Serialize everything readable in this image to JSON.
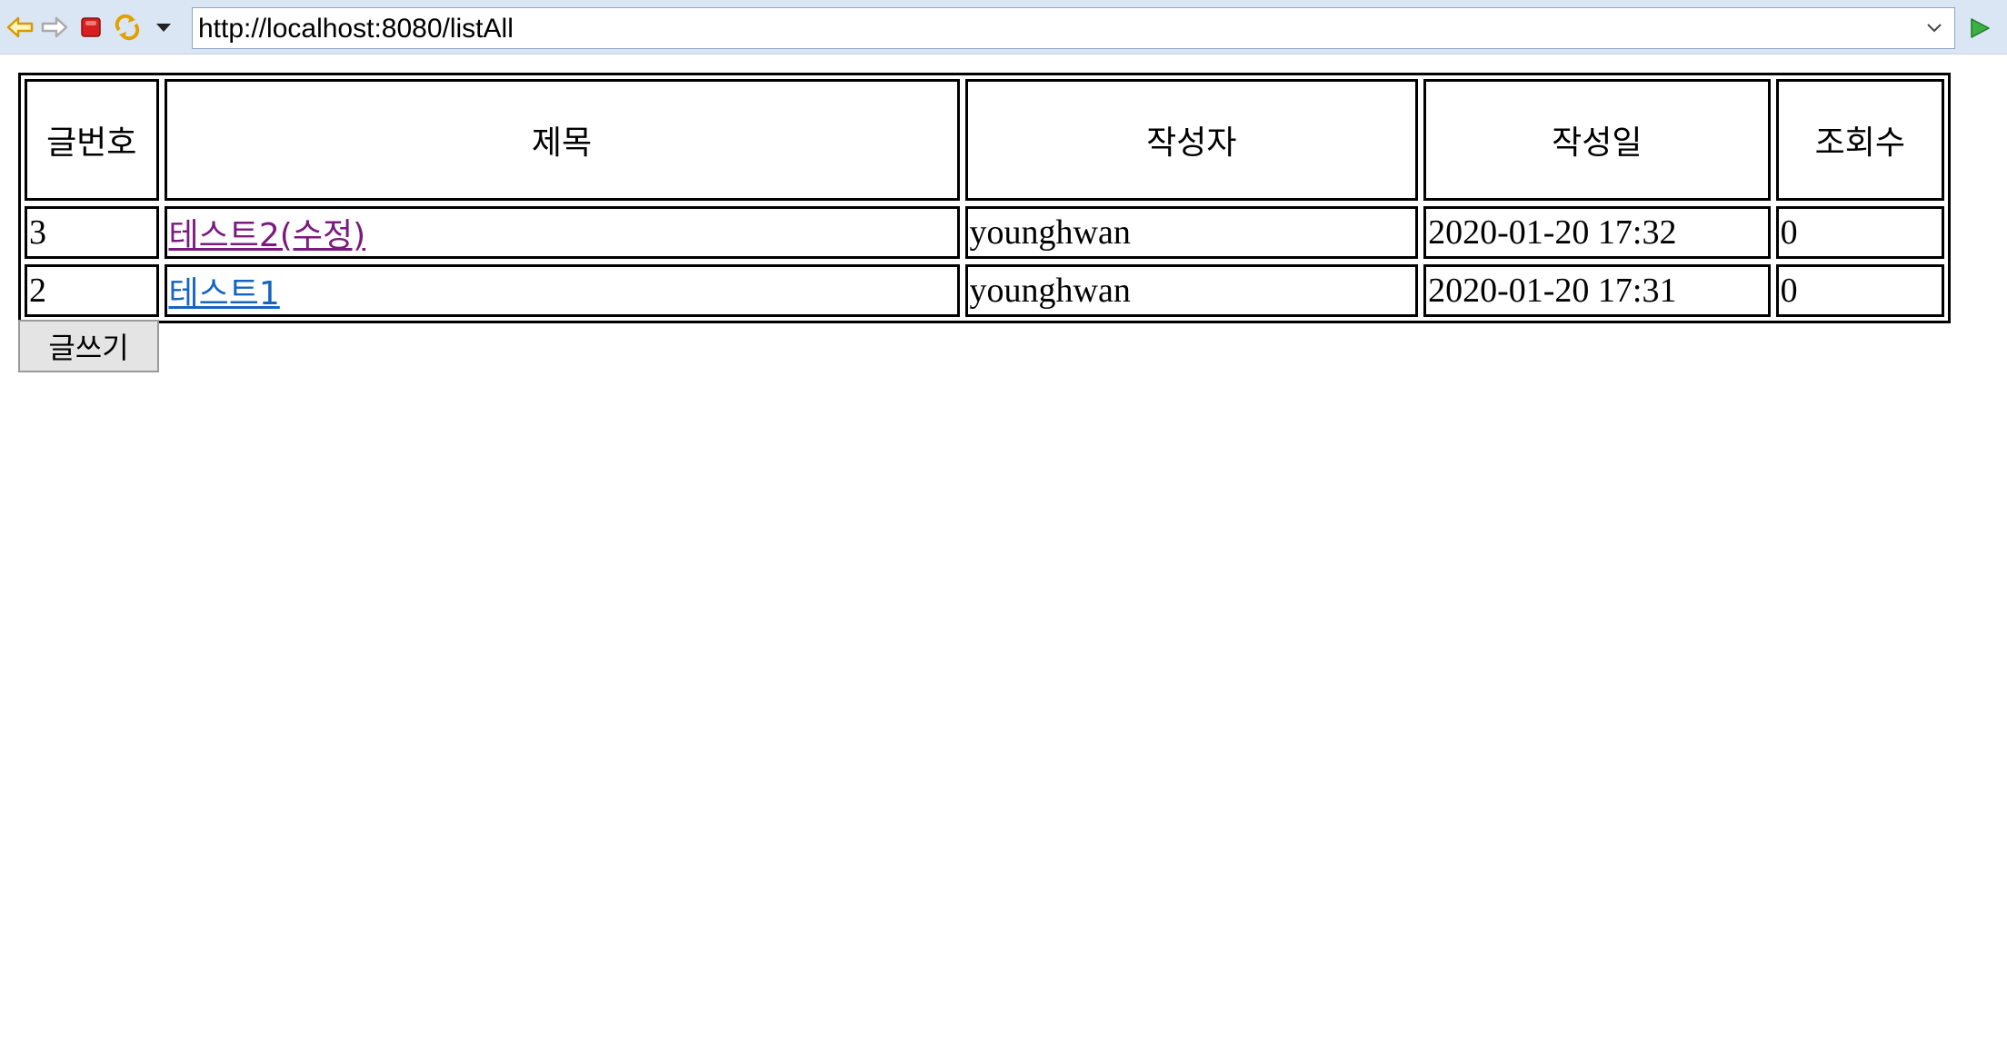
{
  "browser": {
    "url": "http://localhost:8080/listAll",
    "icons": {
      "back": "back-arrow-icon",
      "forward": "forward-arrow-icon",
      "stop": "stop-icon",
      "refresh": "refresh-icon",
      "menu": "dropdown-triangle-icon",
      "url_dropdown": "chevron-down-icon",
      "go": "go-play-icon"
    },
    "colors": {
      "toolbar_bg": "#dbe6f4",
      "back_forward": "#f0b400",
      "stop": "#d71f1f",
      "go": "#2e9a35"
    }
  },
  "board": {
    "columns": [
      "글번호",
      "제목",
      "작성자",
      "작성일",
      "조회수"
    ],
    "rows": [
      {
        "no": "3",
        "title": "테스트2(수정)",
        "writer": "younghwan",
        "date": "2020-01-20 17:32",
        "views": "0",
        "visited": true
      },
      {
        "no": "2",
        "title": "테스트1",
        "writer": "younghwan",
        "date": "2020-01-20 17:31",
        "views": "0",
        "visited": false
      }
    ],
    "colors": {
      "visited_link": "#7b1a7e",
      "unvisited_link": "#1565c0"
    }
  },
  "actions": {
    "write_label": "글쓰기"
  }
}
